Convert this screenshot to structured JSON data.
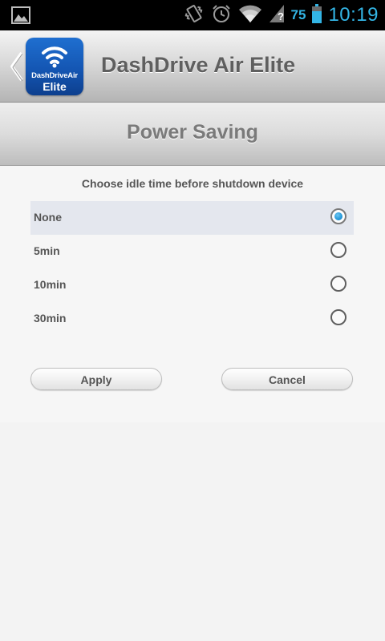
{
  "status_bar": {
    "battery_level": "75",
    "clock": "10:19",
    "icons": [
      "image-notification-icon",
      "vibrate-icon",
      "alarm-icon",
      "wifi-icon",
      "no-signal-icon",
      "battery-icon"
    ]
  },
  "header": {
    "app_title": "DashDrive Air Elite",
    "logo_line1": "DashDriveAir",
    "logo_line2": "Elite"
  },
  "section": {
    "title": "Power Saving"
  },
  "content": {
    "instruction": "Choose idle time before shutdown device",
    "options": [
      {
        "label": "None",
        "selected": true
      },
      {
        "label": "5min",
        "selected": false
      },
      {
        "label": "10min",
        "selected": false
      },
      {
        "label": "30min",
        "selected": false
      }
    ],
    "apply_label": "Apply",
    "cancel_label": "Cancel"
  },
  "colors": {
    "accent_blue": "#33b5e5",
    "radio_fill": "#1e93d6",
    "selected_row": "#e4e7ee"
  }
}
